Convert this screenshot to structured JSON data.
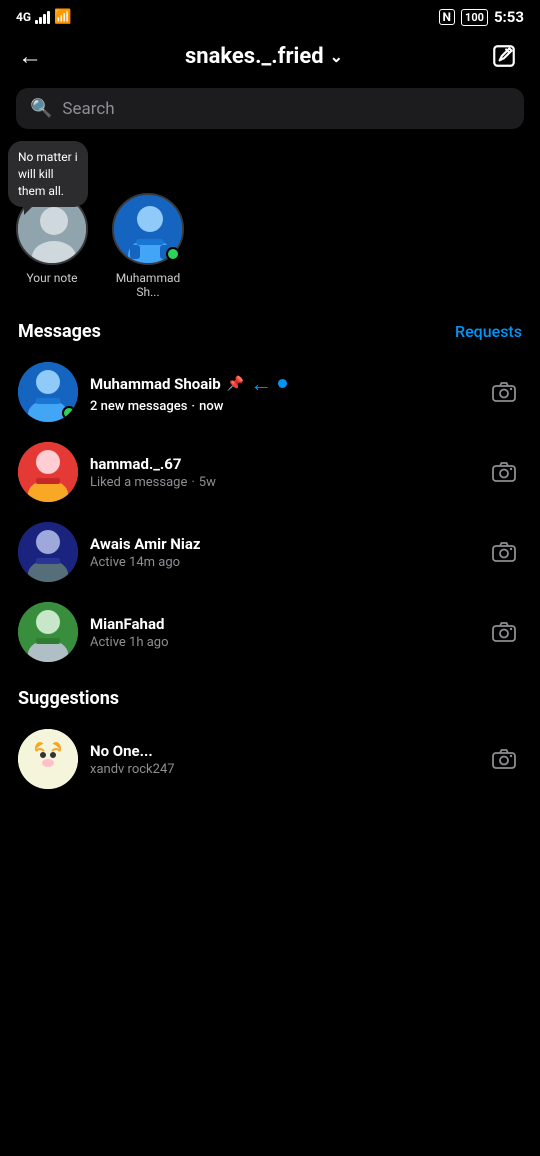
{
  "statusBar": {
    "carrier": "4G",
    "time": "5:53",
    "battery": "100",
    "nfc": "N"
  },
  "header": {
    "title": "snakes._.fried",
    "backLabel": "←",
    "editLabel": "edit"
  },
  "search": {
    "placeholder": "Search"
  },
  "notes": [
    {
      "id": "your-note",
      "label": "Your note",
      "hasBubble": true,
      "bubbleText": "No matter i will kill them all.",
      "hasOnline": false,
      "avatarType": "yournote"
    },
    {
      "id": "muhammad-sh",
      "label": "Muhammad Sh...",
      "hasBubble": false,
      "hasOnline": true,
      "avatarType": "muhamsh"
    }
  ],
  "sections": {
    "messages": "Messages",
    "requests": "Requests",
    "suggestions": "Suggestions"
  },
  "messages": [
    {
      "id": "msg-1",
      "name": "Muhammad Shoaib",
      "sub": "2 new messages",
      "time": "now",
      "pinned": true,
      "hasArrow": true,
      "unread": true,
      "hasOnline": true,
      "avatarType": "shoaib"
    },
    {
      "id": "msg-2",
      "name": "hammad._.67",
      "sub": "Liked a message",
      "time": "5w",
      "pinned": false,
      "hasArrow": false,
      "unread": false,
      "hasOnline": false,
      "avatarType": "hammad"
    },
    {
      "id": "msg-3",
      "name": "Awais Amir Niaz",
      "sub": "Active 14m ago",
      "time": "",
      "pinned": false,
      "hasArrow": false,
      "unread": false,
      "hasOnline": false,
      "avatarType": "awais"
    },
    {
      "id": "msg-4",
      "name": "MianFahad",
      "sub": "Active 1h ago",
      "time": "",
      "pinned": false,
      "hasArrow": false,
      "unread": false,
      "hasOnline": false,
      "avatarType": "fahad"
    }
  ],
  "suggestionItems": [
    {
      "id": "sug-1",
      "name": "No One...",
      "sub": "xandv rock247",
      "avatarType": "noone"
    }
  ]
}
